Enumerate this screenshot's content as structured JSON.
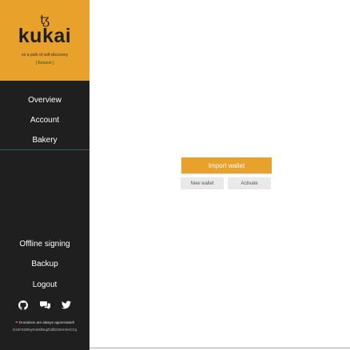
{
  "brand": {
    "symbol": "ꜩ",
    "name": "kukai",
    "tagline": "on a path of self-discovery",
    "network": "[ Betanet ]",
    "color": "#e8a12a"
  },
  "nav": {
    "top": [
      {
        "label": "Overview"
      },
      {
        "label": "Account"
      },
      {
        "label": "Bakery"
      }
    ],
    "bottom": [
      {
        "label": "Offline signing"
      },
      {
        "label": "Backup"
      },
      {
        "label": "Logout"
      }
    ]
  },
  "socials": [
    {
      "icon": "github-icon",
      "glyph": "⬤"
    },
    {
      "icon": "chat-icon",
      "glyph": "💬"
    },
    {
      "icon": "twitter-icon",
      "glyph": "🐦"
    }
  ],
  "donation": {
    "heart": "❤",
    "message": "Donations are always appreciated!",
    "address": "tz1SF33Z9eyFaDsfMujZhdfDGDrrnKHCGq"
  },
  "actions": {
    "import_label": "Import wallet",
    "new_label": "New wallet",
    "activate_label": "Activate"
  }
}
